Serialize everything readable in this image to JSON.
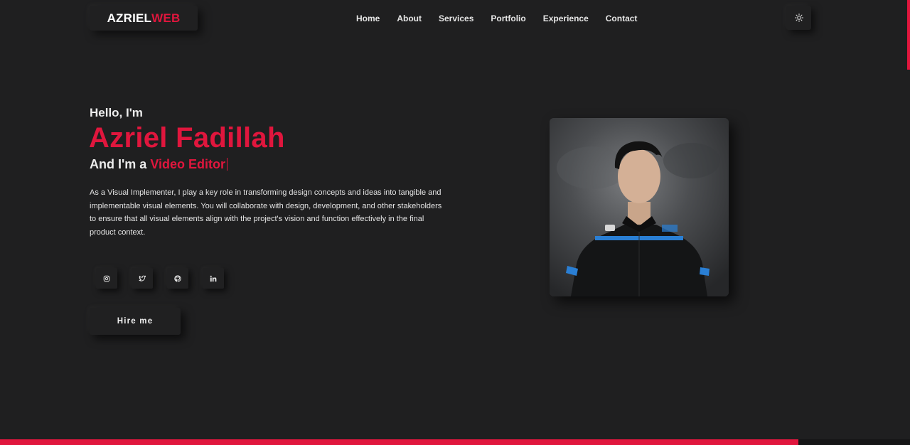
{
  "brand": {
    "part1": "AZRIEL",
    "part2": "WEB",
    "accent_color": "#e0163d"
  },
  "nav": {
    "items": [
      "Home",
      "About",
      "Services",
      "Portfolio",
      "Experience",
      "Contact"
    ]
  },
  "theme_toggle": {
    "icon": "sun-icon"
  },
  "hero": {
    "greeting": "Hello, I'm",
    "name": "Azriel Fadillah",
    "role_prefix": "And I'm a",
    "role_highlight": "Video Editor",
    "description": "As a Visual Implementer, I play a key role in transforming design concepts and ideas into tangible and implementable visual elements. You will collaborate with design, development, and other stakeholders to ensure that all visual elements align with the project's vision and function effectively in the final product context.",
    "socials": [
      "instagram-icon",
      "twitter-icon",
      "github-icon",
      "linkedin-icon"
    ],
    "cta_label": "Hire me"
  },
  "colors": {
    "background": "#1f1f20",
    "accent": "#e0163d",
    "text": "#e9e9e9"
  }
}
